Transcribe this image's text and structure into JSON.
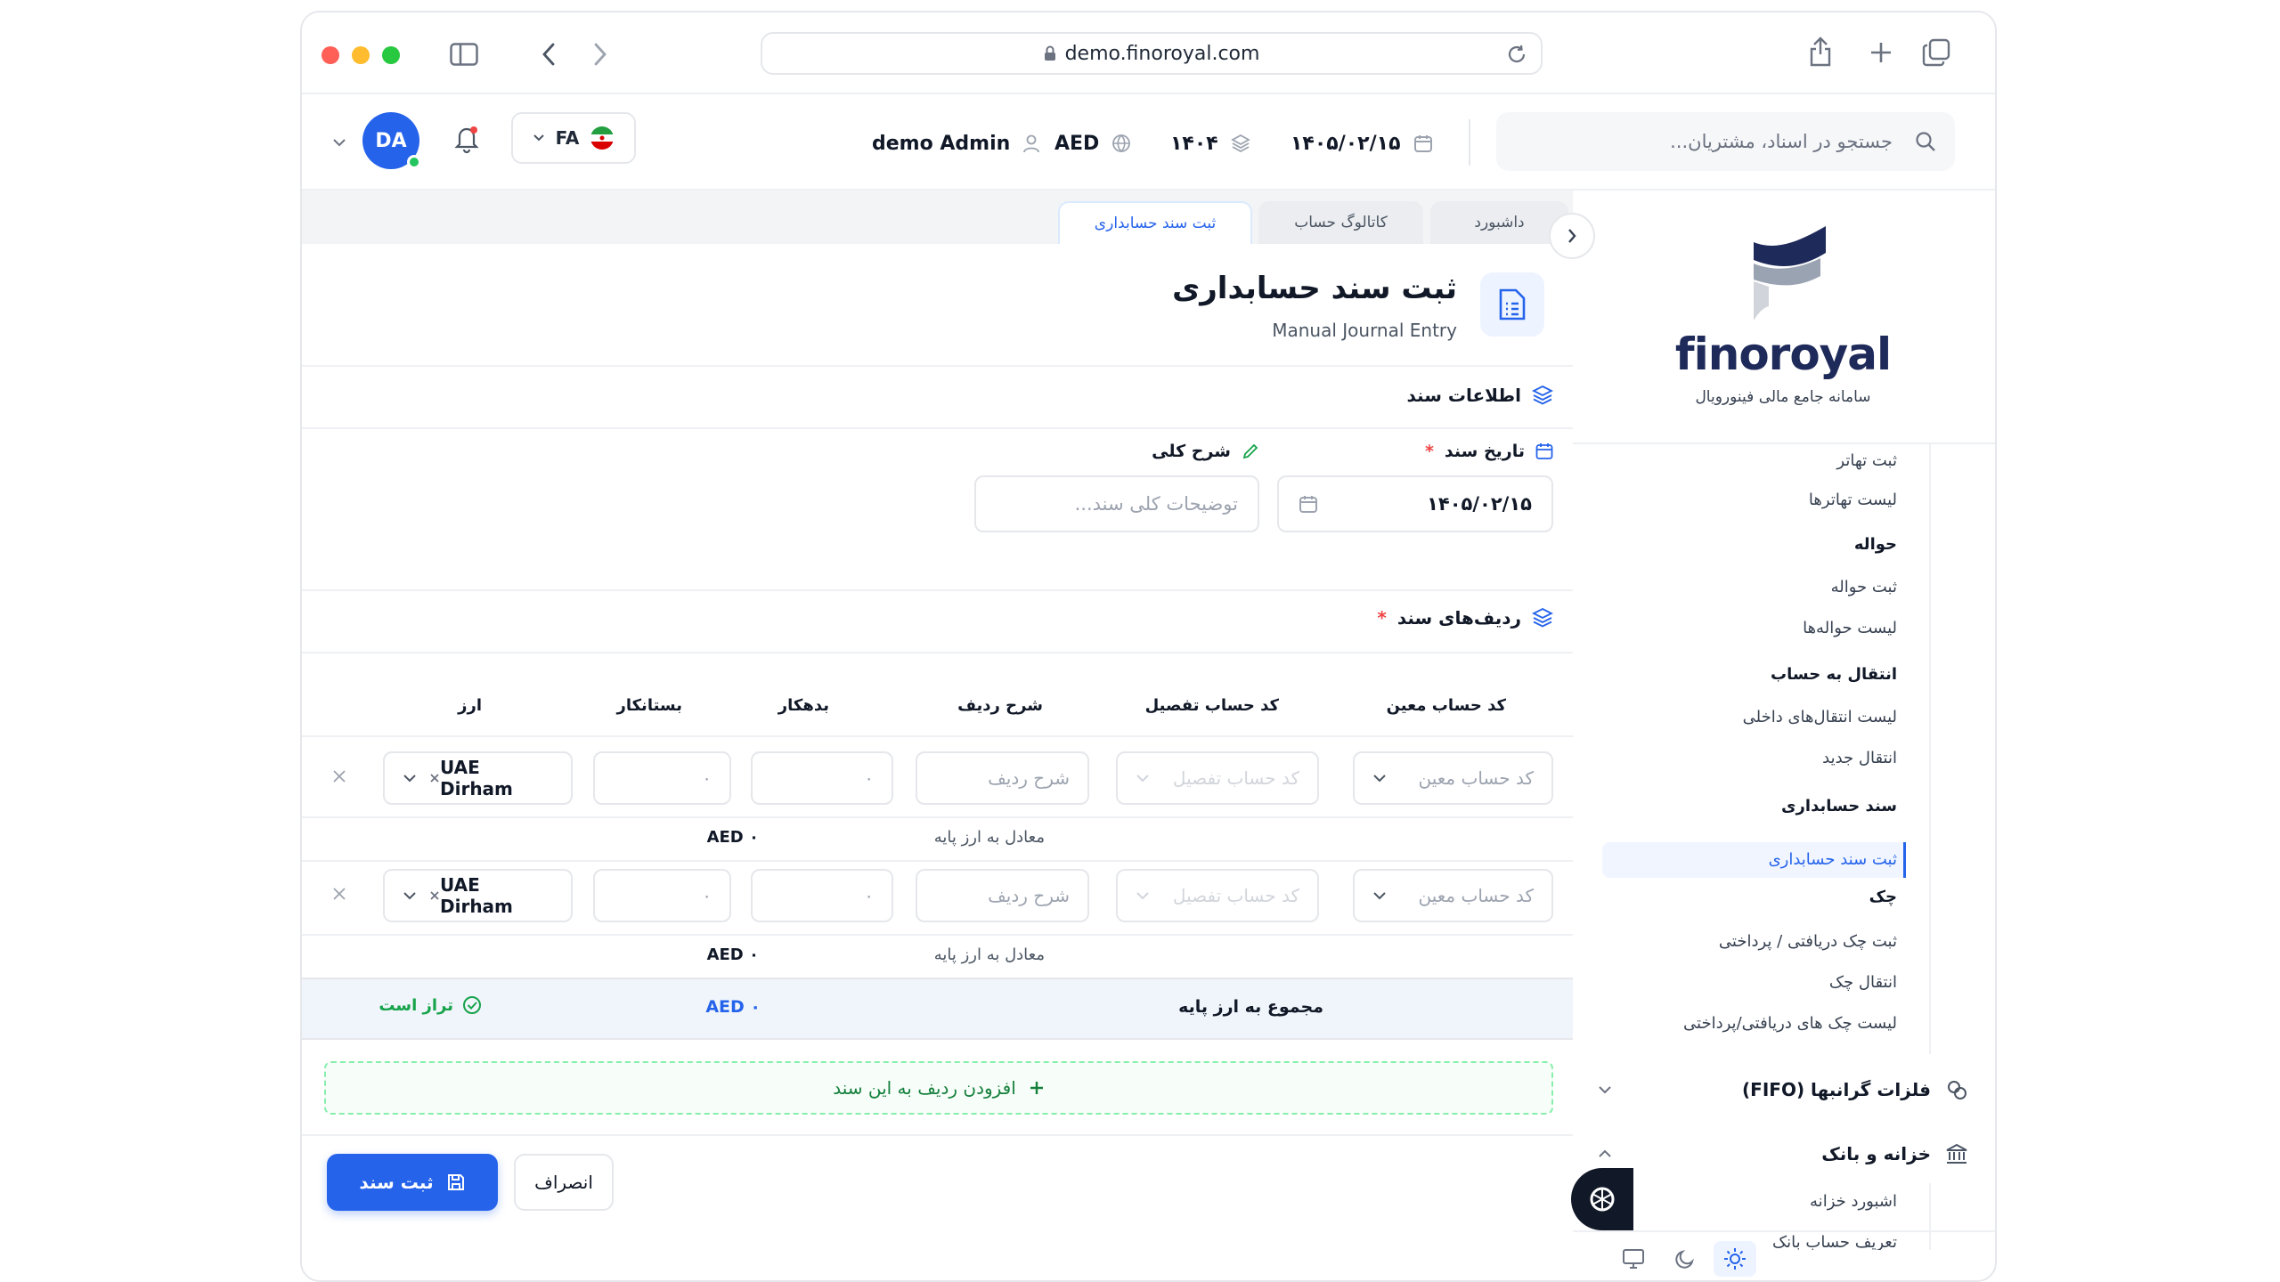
{
  "browser": {
    "url": "demo.finoroyal.com"
  },
  "header": {
    "search_placeholder": "جستجو در اسناد، مشتریان...",
    "date": "۱۴۰۵/۰۲/۱۵",
    "fiscal_year": "۱۴۰۴",
    "currency": "AED",
    "user_name": "demo Admin",
    "language": "FA",
    "avatar_initials": "DA"
  },
  "sidebar": {
    "brand": "finoroyal",
    "brand_subtitle": "سامانه جامع مالی فینورویال",
    "items": [
      {
        "label": "ثبت تهاتر",
        "type": "item"
      },
      {
        "label": "لیست تهاترها",
        "type": "item"
      },
      {
        "label": "حواله",
        "type": "header"
      },
      {
        "label": "ثبت حواله",
        "type": "item"
      },
      {
        "label": "لیست حواله‌ها",
        "type": "item"
      },
      {
        "label": "انتقال به حساب",
        "type": "header"
      },
      {
        "label": "لیست انتقال‌های داخلی",
        "type": "item"
      },
      {
        "label": "انتقال جدید",
        "type": "item"
      },
      {
        "label": "سند حسابداری",
        "type": "header"
      },
      {
        "label": "ثبت سند حسابداری",
        "type": "active"
      },
      {
        "label": "چک",
        "type": "header"
      },
      {
        "label": "ثبت چک دریافتی / پرداختی",
        "type": "item"
      },
      {
        "label": "انتقال چک",
        "type": "item"
      },
      {
        "label": "لیست چک های دریافتی/پرداختی",
        "type": "item"
      }
    ],
    "group_precious": "فلزات گرانبها (FIFO)",
    "group_treasury": "خزانه و بانک",
    "treasury_items": [
      "اشبورد خزانه",
      "تعریف حساب بانک"
    ]
  },
  "tabs": [
    "داشبورد",
    "کاتالوگ حساب",
    "ثبت سند حسابداری"
  ],
  "page": {
    "title": "ثبت سند حسابداری",
    "subtitle": "Manual Journal Entry"
  },
  "doc_info": {
    "section_title": "اطلاعات سند",
    "date_label": "تاریخ سند",
    "date_required": "*",
    "date_value": "۱۴۰۵/۰۲/۱۵",
    "desc_label": "شرح کلی",
    "desc_placeholder": "توضیحات کلی سند..."
  },
  "rows_section": {
    "title": "ردیف‌های سند",
    "required": "*",
    "columns": [
      "کد حساب معین",
      "کد حساب تفصیل",
      "شرح ردیف",
      "بدهکار",
      "بستانکار",
      "ارز"
    ],
    "rows": [
      {
        "account_placeholder": "کد حساب معین",
        "detail_placeholder": "کد حساب تفصیل",
        "desc_placeholder": "شرح ردیف",
        "debit": "۰",
        "credit": "۰",
        "currency": "UAE Dirham",
        "base_label": "معادل به ارز پایه",
        "base_value": "AED ۰"
      },
      {
        "account_placeholder": "کد حساب معین",
        "detail_placeholder": "کد حساب تفصیل",
        "desc_placeholder": "شرح ردیف",
        "debit": "۰",
        "credit": "۰",
        "currency": "UAE Dirham",
        "base_label": "معادل به ارز پایه",
        "base_value": "AED ۰"
      }
    ],
    "total_label": "مجموع به ارز پایه",
    "total_value": "AED ۰",
    "balanced_label": "تراز است",
    "add_row_label": "افزودن ردیف به این سند"
  },
  "actions": {
    "submit": "ثبت سند",
    "cancel": "انصراف"
  },
  "colors": {
    "primary": "#2563eb",
    "success": "#16a34a",
    "brand_navy": "#1e2a5a"
  }
}
